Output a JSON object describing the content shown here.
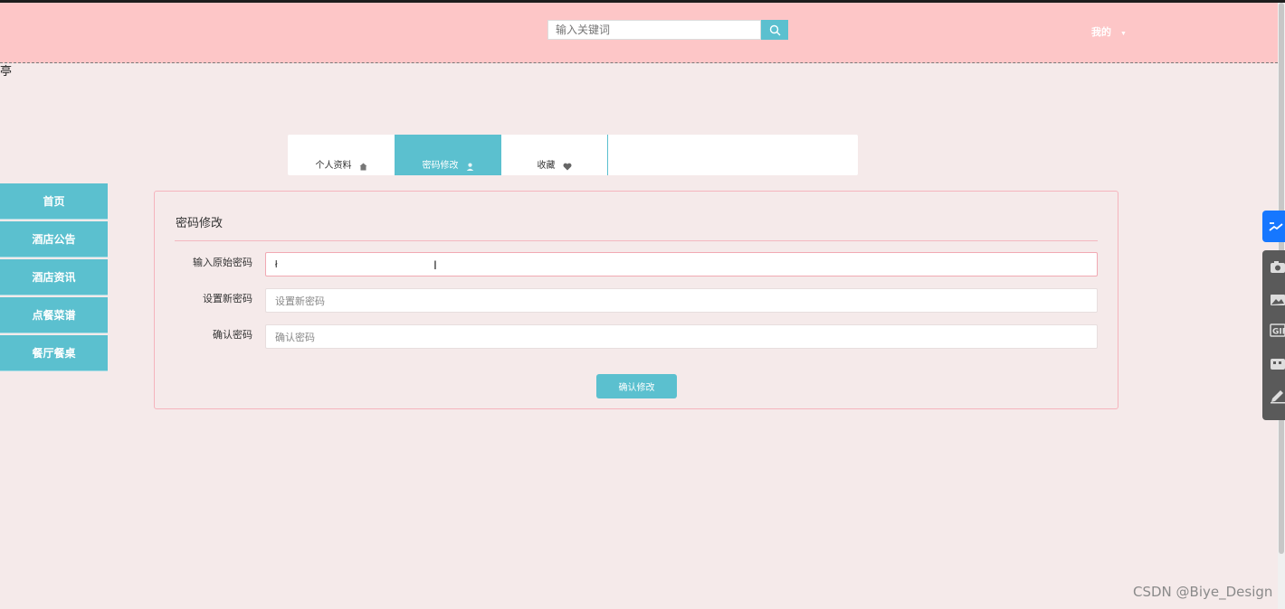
{
  "header": {
    "search_placeholder": "输入关键词",
    "user_menu_label": "我的",
    "caret": "▼"
  },
  "stray_text": "亭",
  "tabs": [
    {
      "label": "个人资料",
      "icon": "home-icon"
    },
    {
      "label": "密码修改",
      "icon": "user-icon",
      "active": true
    },
    {
      "label": "收藏",
      "icon": "heart-icon"
    }
  ],
  "sidebar": {
    "items": [
      {
        "label": "首页"
      },
      {
        "label": "酒店公告"
      },
      {
        "label": "酒店资讯"
      },
      {
        "label": "点餐菜谱"
      },
      {
        "label": "餐厅餐桌"
      }
    ]
  },
  "form": {
    "title": "密码修改",
    "fields": [
      {
        "label": "输入原始密码",
        "value": "ł",
        "placeholder": ""
      },
      {
        "label": "设置新密码",
        "value": "",
        "placeholder": "设置新密码"
      },
      {
        "label": "确认密码",
        "value": "",
        "placeholder": "确认密码"
      }
    ],
    "submit_label": "确认修改"
  },
  "watermark": "CSDN @Biye_Design",
  "colors": {
    "header_bg": "#fdc6c7",
    "page_bg": "#f5eaea",
    "accent": "#5bc0cf",
    "panel_border": "#f5b4bd"
  }
}
